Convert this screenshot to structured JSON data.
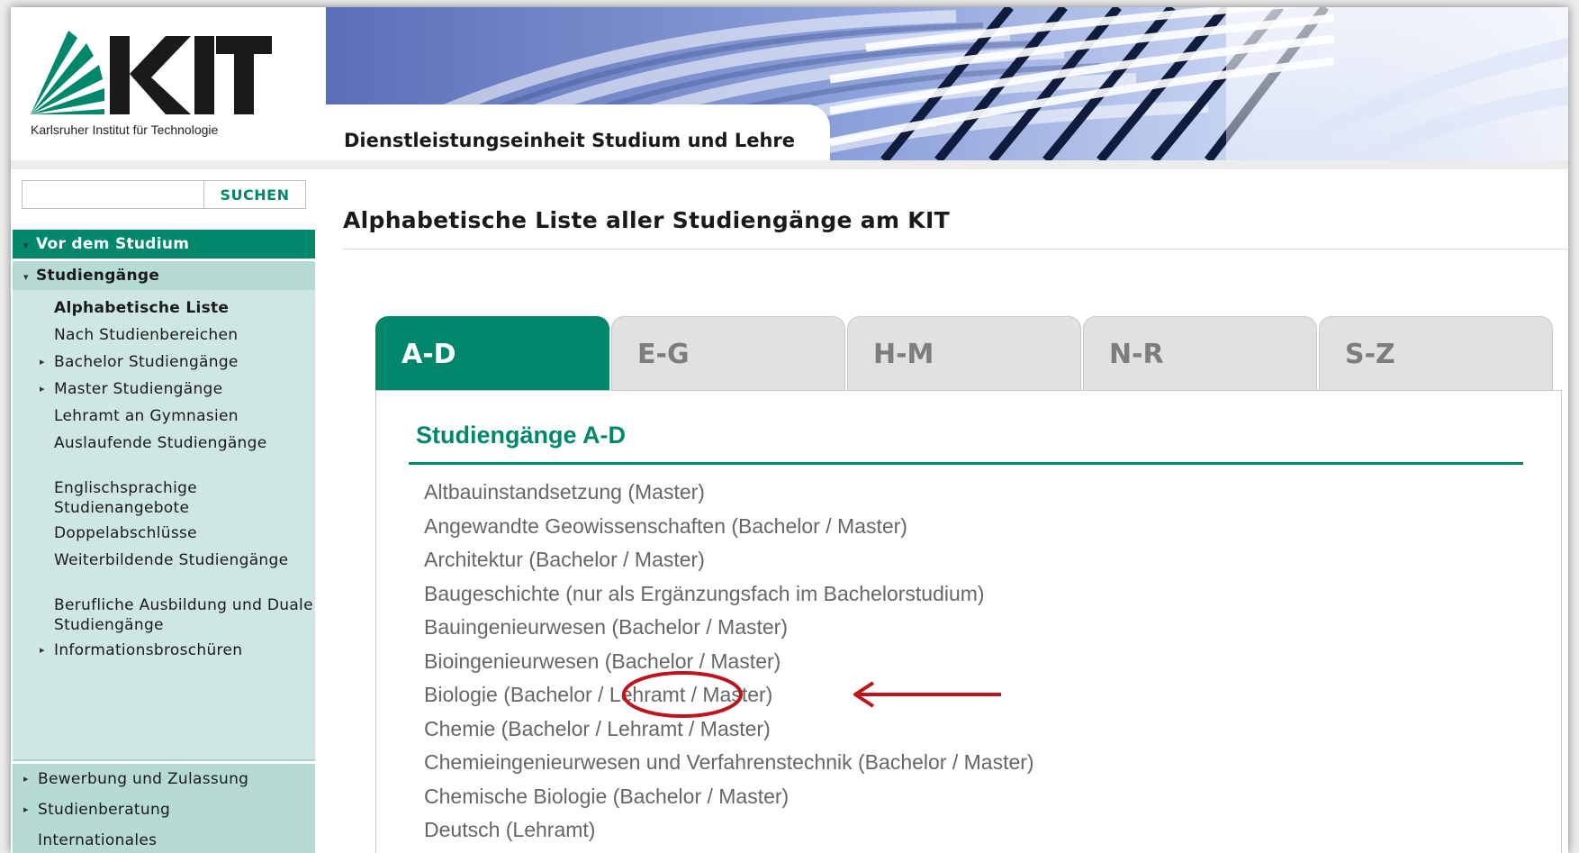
{
  "header": {
    "logo_text": "KIT",
    "logo_subtitle": "Karlsruher Institut für Technologie",
    "banner_title": "Dienstleistungseinheit Studium und Lehre"
  },
  "search": {
    "placeholder": "",
    "value": "",
    "button_label": "SUCHEN"
  },
  "sidebar": {
    "top_item": "Vor dem Studium",
    "sub_header": "Studiengänge",
    "items": [
      {
        "label": "Alphabetische Liste",
        "active": true,
        "has_arrow": false
      },
      {
        "label": "Nach Studienbereichen",
        "has_arrow": false
      },
      {
        "label": "Bachelor Studiengänge",
        "has_arrow": true
      },
      {
        "label": "Master Studiengänge",
        "has_arrow": true
      },
      {
        "label": "Lehramt an Gymnasien",
        "has_arrow": false
      },
      {
        "label": "Auslaufende Studiengänge",
        "has_arrow": false
      },
      {
        "label": "Englischsprachige Studienangebote",
        "has_arrow": false
      },
      {
        "label": "Doppelabschlüsse",
        "has_arrow": false
      },
      {
        "label": "Weiterbildende Studiengänge",
        "has_arrow": false
      },
      {
        "label": "Berufliche Ausbildung und Duale Studiengänge",
        "has_arrow": false
      },
      {
        "label": "Informationsbroschüren",
        "has_arrow": true
      }
    ],
    "sections": [
      {
        "label": "Bewerbung und Zulassung",
        "has_arrow": true
      },
      {
        "label": "Studienberatung",
        "has_arrow": true
      },
      {
        "label": "Internationales Studienvorbereitung",
        "has_arrow": false
      }
    ]
  },
  "main": {
    "page_title": "Alphabetische Liste aller Studiengänge am KIT",
    "tabs": [
      {
        "label": "A-D",
        "active": true
      },
      {
        "label": "E-G"
      },
      {
        "label": "H-M"
      },
      {
        "label": "N-R"
      },
      {
        "label": "S-Z"
      }
    ],
    "panel_heading": "Studiengänge A-D",
    "courses": [
      "Altbauinstandsetzung   (Master)",
      "Angewandte Geowissenschaften   (Bachelor /  Master)",
      "Architektur  (Bachelor /  Master)",
      "Baugeschichte  (nur als Ergänzungsfach im Bachelorstudium)",
      "Bauingenieurwesen  (Bachelor /  Master)",
      "Bioingenieurwesen  (Bachelor /  Master)",
      "Biologie  (Bachelor /  Lehramt /  Master)",
      "Chemie  (Bachelor /  Lehramt /  Master)",
      "Chemieingenieurwesen und Verfahrenstechnik   (Bachelor /  Master)",
      "Chemische Biologie  (Bachelor /  Master)",
      "Deutsch  (Lehramt)"
    ]
  },
  "colors": {
    "accent": "#00876c",
    "sidebar_light": "#cfe7e2",
    "sidebar_mid": "#b5dbd3",
    "annotation": "#c0141c"
  }
}
